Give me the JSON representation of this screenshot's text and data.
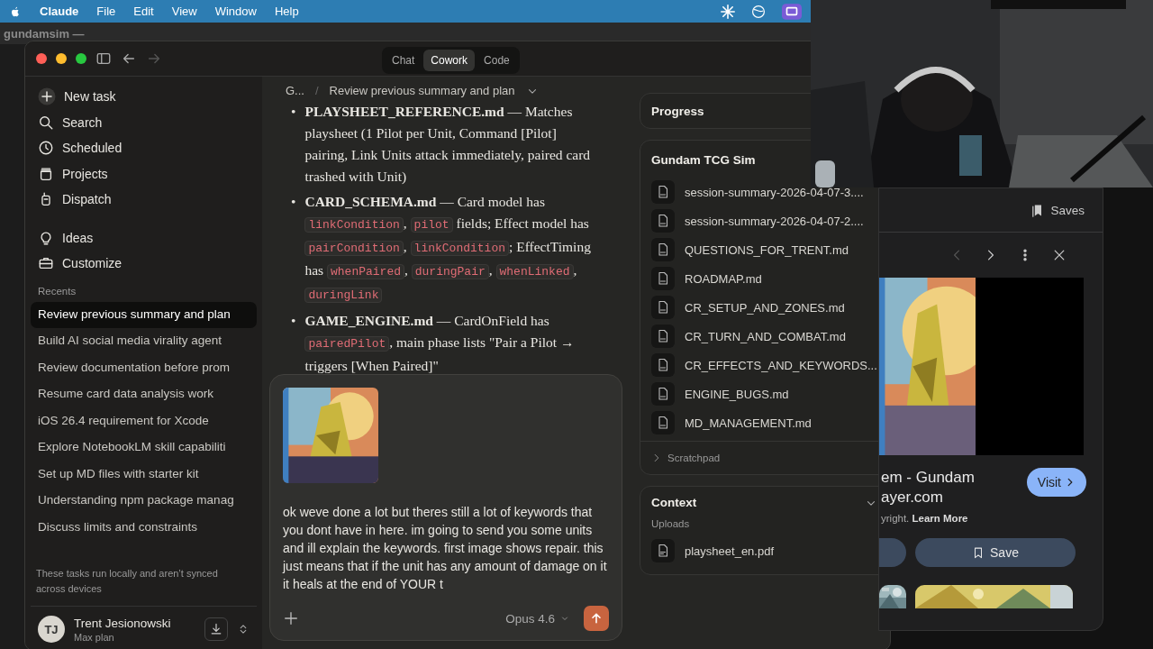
{
  "menu_bar": {
    "app": "Claude",
    "items": [
      "File",
      "Edit",
      "View",
      "Window",
      "Help"
    ]
  },
  "back_window": {
    "title": "gundamsim —"
  },
  "window": {
    "modes": [
      {
        "label": "Chat",
        "selected": false
      },
      {
        "label": "Cowork",
        "selected": true
      },
      {
        "label": "Code",
        "selected": false
      }
    ]
  },
  "sidebar": {
    "nav": [
      {
        "label": "New task"
      },
      {
        "label": "Search"
      },
      {
        "label": "Scheduled"
      },
      {
        "label": "Projects"
      },
      {
        "label": "Dispatch"
      }
    ],
    "tools": [
      {
        "label": "Ideas"
      },
      {
        "label": "Customize"
      }
    ],
    "recents_label": "Recents",
    "recents": [
      {
        "label": "Review previous summary and plan",
        "selected": true
      },
      {
        "label": "Build AI social media virality agent",
        "selected": false
      },
      {
        "label": "Review documentation before prom",
        "selected": false
      },
      {
        "label": "Resume card data analysis work",
        "selected": false
      },
      {
        "label": "iOS 26.4 requirement for Xcode",
        "selected": false
      },
      {
        "label": "Explore NotebookLM skill capabiliti",
        "selected": false
      },
      {
        "label": "Set up MD files with starter kit",
        "selected": false
      },
      {
        "label": "Understanding npm package manag",
        "selected": false
      },
      {
        "label": "Discuss limits and constraints",
        "selected": false
      }
    ],
    "note": "These tasks run locally and aren’t synced across devices",
    "user": {
      "initials": "TJ",
      "name": "Trent Jesionowski",
      "plan": "Max plan"
    }
  },
  "breadcrumb": {
    "parent": "G...",
    "separator": "/",
    "title": "Review previous summary and plan"
  },
  "message": {
    "marker": "•",
    "bullets": [
      [
        {
          "kind": "bold",
          "text": "PLAYSHEET_REFERENCE.md"
        },
        {
          "kind": "text",
          "text": " — Matches playsheet (1 Pilot per Unit, Command [Pilot] pairing, Link Units attack immediately, paired card trashed with Unit)"
        }
      ],
      [
        {
          "kind": "bold",
          "text": "CARD_SCHEMA.md"
        },
        {
          "kind": "text",
          "text": " — Card model has "
        },
        {
          "kind": "code",
          "text": "linkCondition"
        },
        {
          "kind": "text",
          "text": ", "
        },
        {
          "kind": "code",
          "text": "pilot"
        },
        {
          "kind": "text",
          "text": " fields; Effect model has "
        },
        {
          "kind": "code",
          "text": "pairCondition"
        },
        {
          "kind": "text",
          "text": ", "
        },
        {
          "kind": "code",
          "text": "linkCondition"
        },
        {
          "kind": "text",
          "text": "; EffectTiming has "
        },
        {
          "kind": "code",
          "text": "whenPaired"
        },
        {
          "kind": "text",
          "text": ", "
        },
        {
          "kind": "code",
          "text": "duringPair"
        },
        {
          "kind": "text",
          "text": ", "
        },
        {
          "kind": "code",
          "text": "whenLinked"
        },
        {
          "kind": "text",
          "text": ", "
        },
        {
          "kind": "code",
          "text": "duringLink"
        }
      ],
      [
        {
          "kind": "bold",
          "text": "GAME_ENGINE.md"
        },
        {
          "kind": "text",
          "text": " — CardOnField has "
        },
        {
          "kind": "code",
          "text": "pairedPilot"
        },
        {
          "kind": "text",
          "text": ", main phase lists \"Pair a Pilot → triggers [When Paired]\""
        }
      ]
    ]
  },
  "composer": {
    "text": "ok weve done a lot but theres still a lot of keywords that you dont have in here. im going to send you some units and ill explain the keywords. first image shows repair. this just means that if the unit has any amount of damage on it it heals at the end of YOUR t",
    "model": "Opus 4.6"
  },
  "progress": {
    "title": "Progress"
  },
  "project": {
    "title": "Gundam TCG Sim",
    "files": [
      {
        "name": "session-summary-2026-04-07-3...."
      },
      {
        "name": "session-summary-2026-04-07-2...."
      },
      {
        "name": "QUESTIONS_FOR_TRENT.md"
      },
      {
        "name": "ROADMAP.md"
      },
      {
        "name": "CR_SETUP_AND_ZONES.md"
      },
      {
        "name": "CR_TURN_AND_COMBAT.md"
      },
      {
        "name": "CR_EFFECTS_AND_KEYWORDS..."
      },
      {
        "name": "ENGINE_BUGS.md"
      },
      {
        "name": "MD_MANAGEMENT.md"
      }
    ],
    "scratchpad": "Scratchpad"
  },
  "context": {
    "title": "Context",
    "uploads_label": "Uploads",
    "files": [
      {
        "name": "playsheet_en.pdf"
      }
    ]
  },
  "image_viewer": {
    "saves": "Saves",
    "title_lines": [
      "em - Gundam",
      "ayer.com"
    ],
    "visit": "Visit",
    "notice": "yright. **Learn More**",
    "save": "Save"
  }
}
